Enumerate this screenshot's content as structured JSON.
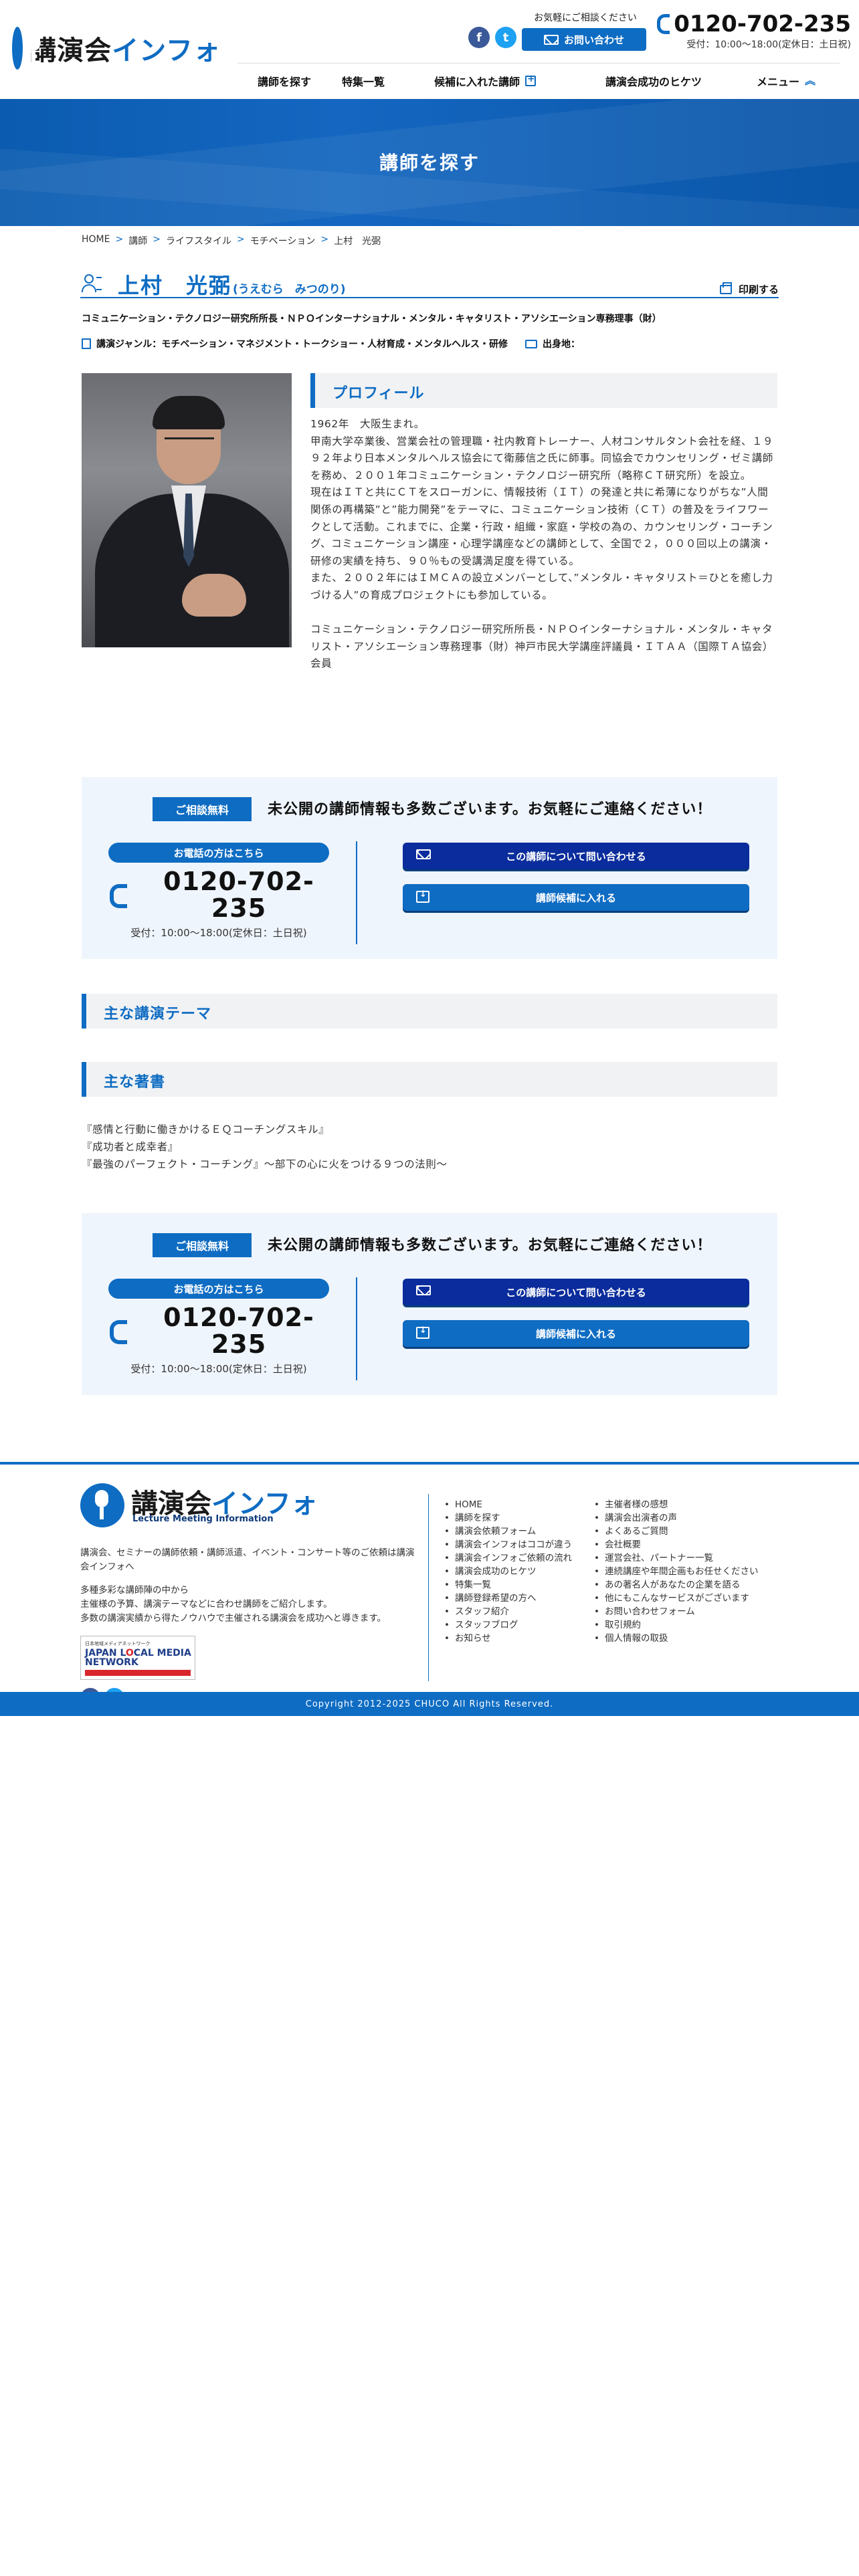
{
  "header": {
    "logo_main": "講演会",
    "logo_accent": "インフォ",
    "consult_lead": "お気軽にご相談ください",
    "contact_button": "お問い合わせ",
    "phone": "0120-702-235",
    "hours": "受付：10:00〜18:00(定休日：土日祝)",
    "nav": [
      {
        "label": "講師を探す"
      },
      {
        "label": "特集一覧"
      },
      {
        "label": "候補に入れた講師"
      },
      {
        "label": "講演会成功のヒケツ"
      },
      {
        "label": "メニュー"
      }
    ]
  },
  "hero": {
    "title": "講師を探す"
  },
  "breadcrumb": [
    "HOME",
    "講師",
    "ライフスタイル",
    "モチベーション",
    "上村　光弼"
  ],
  "breadcrumb_sep": ">",
  "speaker": {
    "name": "上村　光弼",
    "kana": "(うえむら　みつのり)",
    "print_label": "印刷する",
    "title": "コミュニケーション・テクノロジー研究所所長・ＮＰＯインターナショナル・メンタル・キャタリスト・アソシエーション専務理事（財）",
    "genre": "講演ジャンル：モチベーション・マネジメント・トークショー・人材育成・メンタルヘルス・研修",
    "birthplace_label": "出身地：",
    "profile_heading": "プロフィール",
    "profile_paragraphs": [
      "1962年　大阪生まれ。",
      "甲南大学卒業後、営業会社の管理職・社内教育トレーナー、人材コンサルタント会社を経、１９９２年より日本メンタルヘルス協会にて衛藤信之氏に師事。同協会でカウンセリング・ゼミ講師を務め、２００１年コミュニケーション・テクノロジー研究所（略称ＣＴ研究所）を設立。",
      "現在はＩＴと共にＣＴをスローガンに、情報技術（ＩＴ）の発達と共に希薄になりがちな”人間関係の再構築”と”能力開発”をテーマに、コミュニケーション技術（ＣＴ）の普及をライフワークとして活動。これまでに、企業・行政・組織・家庭・学校の為の、カウンセリング・コーチング、コミュニケーション講座・心理学講座などの講師として、全国で２，０００回以上の講演・研修の実績を持ち、９０％もの受講満足度を得ている。",
      "また、２００２年にはＩＭＣＡの設立メンバーとして、”メンタル・キャタリスト＝ひとを癒し力づける人”の育成プロジェクトにも参加している。",
      "",
      "コミュニケーション・テクノロジー研究所所長・ＮＰＯインターナショナル・メンタル・キャタリスト・アソシエーション専務理事（財）神戸市民大学講座評議員・ＩＴＡＡ（国際ＴＡ協会）会員"
    ]
  },
  "contact_box": {
    "badge": "ご相談無料",
    "lead": "未公開の講師情報も多数ございます。お気軽にご連絡ください！",
    "phone_tag": "お電話の方はこちら",
    "phone_line1": "0120-702-",
    "phone_line2": "235",
    "hours": "受付：10:00〜18:00(定休日：土日祝)",
    "inquire_button": "この講師について問い合わせる",
    "candidate_button": "講師候補に入れる"
  },
  "sections": {
    "themes_heading": "主な講演テーマ",
    "books_heading": "主な著書"
  },
  "books": [
    "『感情と行動に働きかけるＥＱコーチングスキル』",
    "『成功者と成幸者』",
    "『最強のパーフェクト・コーチング』〜部下の心に火をつける９つの法則〜"
  ],
  "footer": {
    "logo_main": "講演会",
    "logo_accent": "インフォ",
    "logo_sub": "Lecture Meeting Information",
    "desc1": "講演会、セミナーの講師依頼・講師派遣、イベント・コンサート等のご依頼は講演会インフォへ",
    "desc2a": "多種多彩な講師陣の中から",
    "desc2b": "主催様の予算、講演テーマなどに合わせ講師をご紹介します。",
    "desc2c": "多数の講演実績から得たノウハウで主催される講演会を成功へと導きます。",
    "jlmn_top": "日本地域メディアネットワーク",
    "jlmn_line1": "JAPAN L",
    "jlmn_o": "O",
    "jlmn_line1b": "CAL MEDIA",
    "jlmn_line2": "NETWORK",
    "links_left": [
      "HOME",
      "講師を探す",
      "講演会依頼フォーム",
      "講演会インフォはココが違う",
      "講演会インフォご依頼の流れ",
      "講演会成功のヒケツ",
      "特集一覧",
      "講師登録希望の方へ",
      "スタッフ紹介",
      "スタッフブログ",
      "お知らせ"
    ],
    "links_right": [
      "主催者様の感想",
      "講演会出演者の声",
      "よくあるご質問",
      "会社概要",
      "運営会社、パートナー一覧",
      "連続講座や年間企画もお任せください",
      "あの著名人があなたの企業を語る",
      "他にもこんなサービスがございます",
      "お問い合わせフォーム",
      "取引規約",
      "個人情報の取扱"
    ],
    "copyright": "Copyright 2012-2025 CHUCO All Rights Reserved."
  },
  "icons": {
    "facebook": "f",
    "twitter": "t"
  },
  "colors": {
    "brand_blue": "#0e6cc3",
    "navy_button": "#0a2c9c",
    "box_bg": "#eff5fc"
  }
}
